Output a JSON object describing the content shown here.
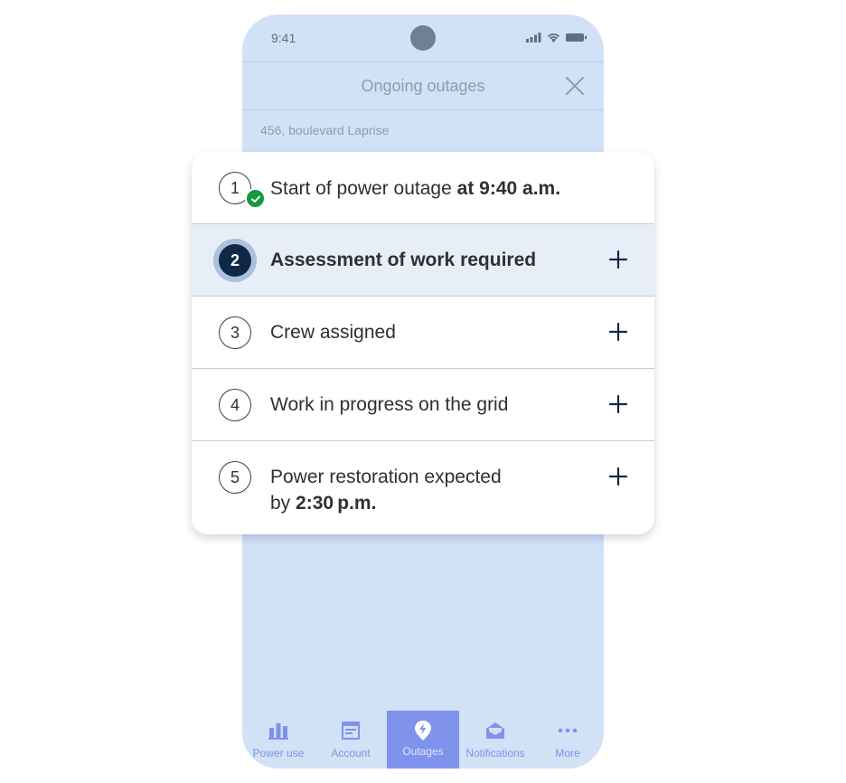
{
  "status_bar": {
    "time": "9:41"
  },
  "header": {
    "title": "Ongoing outages"
  },
  "address": "456, boulevard Laprise",
  "steps": [
    {
      "number": "1",
      "text": "Start of power outage ",
      "bold": "at 9:40 a.m.",
      "state": "completed"
    },
    {
      "number": "2",
      "text": "Assessment of work required",
      "state": "current"
    },
    {
      "number": "3",
      "text": "Crew assigned",
      "state": "pending"
    },
    {
      "number": "4",
      "text": "Work in progress on the grid",
      "state": "pending"
    },
    {
      "number": "5",
      "text": "Power restoration expected",
      "text_line2": "by ",
      "bold": "2:30 p.m.",
      "state": "pending"
    }
  ],
  "tabbar": {
    "tabs": [
      {
        "label": "Power use",
        "icon": "bar-chart-icon"
      },
      {
        "label": "Account",
        "icon": "bill-icon"
      },
      {
        "label": "Outages",
        "icon": "lightning-pin-icon",
        "active": true
      },
      {
        "label": "Notifications",
        "icon": "envelope-icon"
      },
      {
        "label": "More",
        "icon": "more-dots-icon"
      }
    ]
  },
  "colors": {
    "phone_bg": "#d1e1f6",
    "accent": "#7f92ec",
    "current_step": "#0f2848",
    "success": "#159a3c",
    "active_row": "#e7eef7"
  }
}
